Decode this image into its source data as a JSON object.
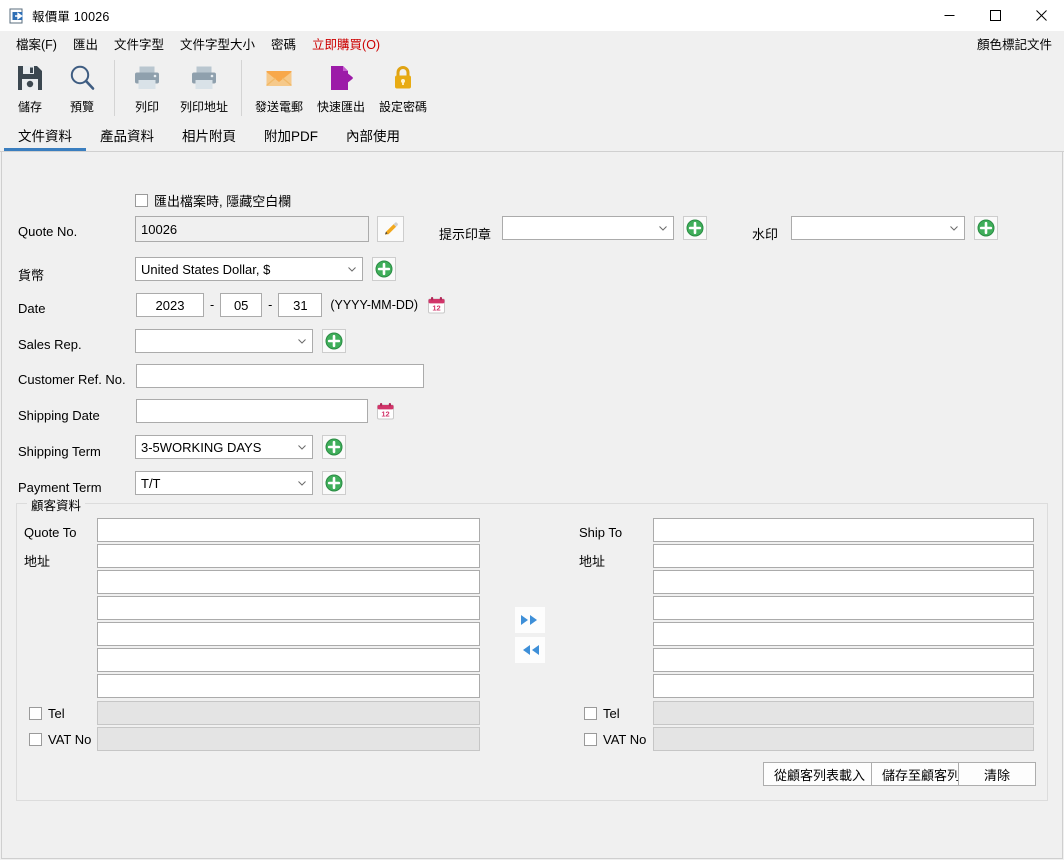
{
  "window": {
    "title": "報價單 10026",
    "icon": "export-document-icon",
    "controls": [
      {
        "name": "minimize",
        "glyph": "minimize-icon"
      },
      {
        "name": "maximize",
        "glyph": "maximize-icon"
      },
      {
        "name": "close",
        "glyph": "close-icon"
      }
    ]
  },
  "menubar": {
    "items": [
      {
        "label": "檔案(F)",
        "accel": "F",
        "highlight": false
      },
      {
        "label": "匯出",
        "highlight": false
      },
      {
        "label": "文件字型",
        "highlight": false
      },
      {
        "label": "文件字型大小",
        "highlight": false
      },
      {
        "label": "密碼",
        "highlight": false
      },
      {
        "label": "立即購買(O)",
        "accel": "O",
        "highlight": true
      }
    ],
    "right_label": "顏色標記文件",
    "highlight_color": "#cc0000"
  },
  "toolbar": {
    "buttons": [
      {
        "label": "儲存",
        "icon": "floppy-disk-icon"
      },
      {
        "label": "預覽",
        "icon": "magnifier-icon"
      },
      {
        "label": "列印",
        "icon": "printer-icon"
      },
      {
        "label": "列印地址",
        "icon": "printer-address-icon"
      },
      {
        "label": "發送電郵",
        "icon": "envelope-icon"
      },
      {
        "label": "快速匯出",
        "icon": "quick-export-icon"
      },
      {
        "label": "設定密碼",
        "icon": "padlock-icon"
      }
    ]
  },
  "tabs": [
    {
      "label": "文件資料",
      "active": true
    },
    {
      "label": "產品資料",
      "active": false
    },
    {
      "label": "相片附頁",
      "active": false
    },
    {
      "label": "附加PDF",
      "active": false
    },
    {
      "label": "內部使用",
      "active": false
    }
  ],
  "form": {
    "hide_empty_checkbox": {
      "label": "匯出檔案時, 隱藏空白欄",
      "checked": false
    },
    "quote_no": {
      "label": "Quote No.",
      "value": "10026",
      "readonly": true
    },
    "notice_stamp": {
      "label": "提示印章",
      "value": "",
      "add": "+"
    },
    "watermark": {
      "label": "水印",
      "value": "",
      "add": "+"
    },
    "currency": {
      "label": "貨幣",
      "value": "United States Dollar, $",
      "add": "+"
    },
    "date": {
      "label": "Date",
      "year": "2023",
      "month": "05",
      "day": "31",
      "format_hint": "(YYYY-MM-DD)"
    },
    "sales_rep": {
      "label": "Sales Rep.",
      "value": "",
      "add": "+"
    },
    "customer_ref_no": {
      "label": "Customer Ref. No.",
      "value": ""
    },
    "shipping_date": {
      "label": "Shipping Date",
      "value": ""
    },
    "shipping_term": {
      "label": "Shipping Term",
      "value": "3-5WORKING DAYS",
      "add": "+"
    },
    "payment_term": {
      "label": "Payment Term",
      "value": "T/T",
      "add": "+"
    }
  },
  "customer_group": {
    "title": "顧客資料",
    "quote_to": {
      "label": "Quote To",
      "address_label": "地址",
      "value": "",
      "address_lines": [
        "",
        "",
        "",
        "",
        "",
        ""
      ],
      "tel": {
        "label": "Tel",
        "checked": false,
        "value": "",
        "disabled": true
      },
      "vat": {
        "label": "VAT No",
        "checked": false,
        "value": "",
        "disabled": true
      }
    },
    "ship_to": {
      "label": "Ship To",
      "address_label": "地址",
      "value": "",
      "address_lines": [
        "",
        "",
        "",
        "",
        "",
        ""
      ],
      "tel": {
        "label": "Tel",
        "checked": false,
        "value": "",
        "disabled": true
      },
      "vat": {
        "label": "VAT No",
        "checked": false,
        "value": "",
        "disabled": true
      }
    },
    "copy_right_button": {
      "name": "copy-to-ship-to",
      "icon": "double-arrow-right-icon"
    },
    "copy_left_button": {
      "name": "copy-to-quote-to",
      "icon": "double-arrow-left-icon"
    },
    "actions": [
      {
        "label": "從顧客列表載入"
      },
      {
        "label": "儲存至顧客列表"
      },
      {
        "label": "清除"
      }
    ]
  },
  "colors": {
    "accent": "#3a7ebf",
    "buy_now": "#cc0000",
    "plus_green": "#2fa44f",
    "arrow_blue": "#3d8fd8",
    "window_bg": "#f0f0f0"
  }
}
